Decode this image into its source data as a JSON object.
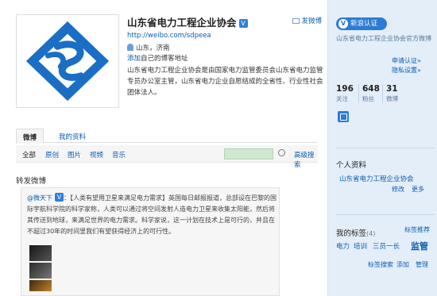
{
  "profile": {
    "name": "山东省电力工程企业协会",
    "verified_badge": "V",
    "private_message": "发微博",
    "url": "http://weibo.com/sdpeea",
    "location": "山东，济南",
    "add_prefix": "添加",
    "add_suffix": "自己的博客地址",
    "description": "山东省电力工程企业协会是由国家电力监管委员会山东省电力监管专员办公室主管，山东省电力企业自愿结成的全省性、行业性社会团体法人。"
  },
  "tabs": [
    {
      "label": "微博"
    },
    {
      "label": "我的资料"
    }
  ],
  "filters": [
    "全部",
    "原创",
    "图片",
    "视频",
    "音乐"
  ],
  "search": {
    "advanced_label": "高级搜索"
  },
  "section_title": "转发微博",
  "repost": {
    "user": "@微天下",
    "badge": "V",
    "text": "：【人类有望用卫星来满足电力需求】英国每日邮报报道，总部设在巴黎的国际宇航科学院的科学家称，人类可以通过将空间发射人造电力卫星来收集太阳能，然后将其传送到地球，来满足世界的电力需求。科学家说，这一计划在技术上是可行的，并且在不超过30年的时间里我们有望获得经济上的可行性。"
  },
  "sidebar": {
    "verify_label": "新浪认证",
    "verify_icon": "V",
    "verify_desc": "山东省电力工程企业协会官方微博",
    "apply_link": "申请认证»",
    "privacy_link": "隐私设置»",
    "stats": [
      {
        "num": "196",
        "label": "关注"
      },
      {
        "num": "648",
        "label": "粉丝"
      },
      {
        "num": "31",
        "label": "微博"
      }
    ],
    "profile_title": "个人资料",
    "profile_link": "山东省电力工程企业协会",
    "modify_link": "修改",
    "more_link": "更多",
    "tags_title": "我的标签",
    "tags_count": "(4)",
    "tag_recommend": "标签推荐",
    "tags": [
      "电力",
      "培训",
      "三员一长",
      "监管"
    ],
    "tag_search": "标签搜索",
    "tag_add": "添加",
    "tag_manage": "管理"
  },
  "colors": {
    "accent": "#2b7bd8",
    "sidebar_bg": "#e4eef9",
    "link": "#0a5eb2",
    "logo_blue": "#1a6fc4"
  }
}
